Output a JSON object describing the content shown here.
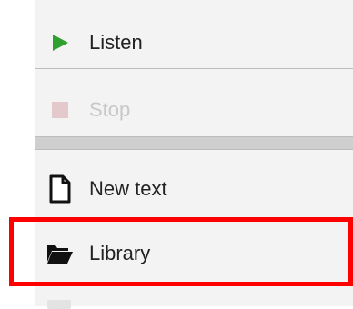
{
  "menu": {
    "items": [
      {
        "label": "Listen",
        "icon": "play-icon",
        "enabled": true,
        "icon_color": "#2ea02e"
      },
      {
        "label": "Stop",
        "icon": "stop-icon",
        "enabled": false,
        "icon_color": "#e4c9cc"
      },
      {
        "label": "New text",
        "icon": "new-document-icon",
        "enabled": true
      },
      {
        "label": "Library",
        "icon": "folder-open-icon",
        "enabled": true,
        "highlighted": true
      }
    ]
  },
  "colors": {
    "highlight": "#ff0000",
    "panel_background": "#f3f3f3",
    "disabled_text": "#c8c8c8"
  }
}
